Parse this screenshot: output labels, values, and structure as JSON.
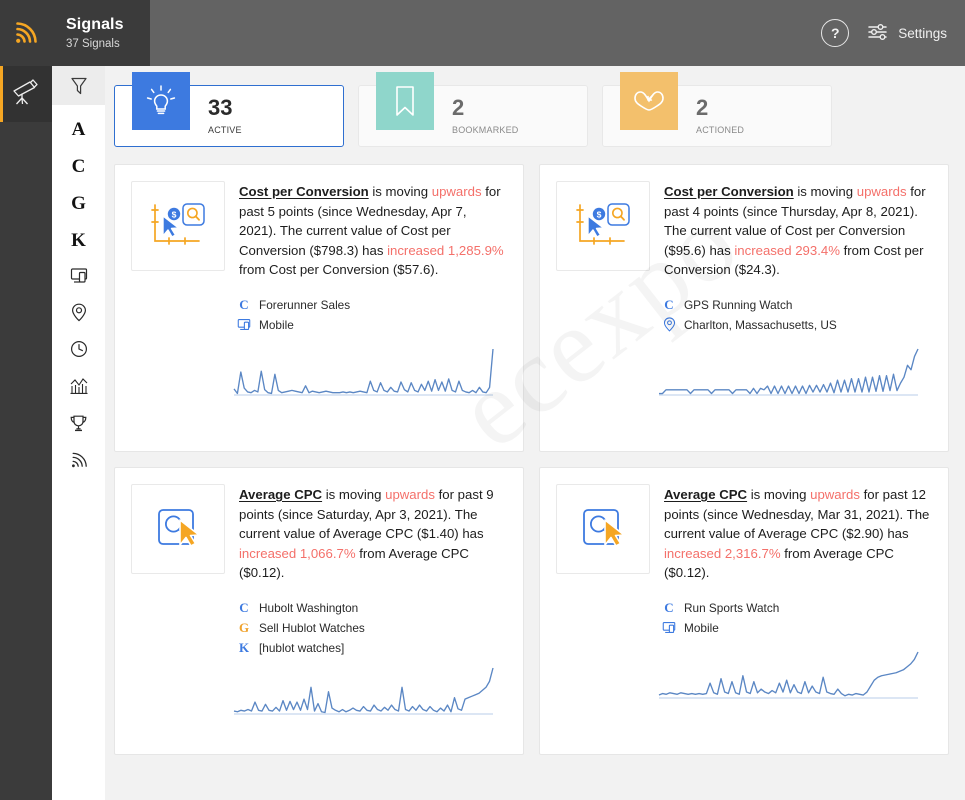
{
  "header": {
    "brand_icon": "rss-signal-icon",
    "title": "Signals",
    "subtitle": "37 Signals",
    "help_label": "?",
    "settings_label": "Settings"
  },
  "rail": {
    "active_item": "telescope-icon"
  },
  "filters": {
    "top_icon": "funnel-filter-icon",
    "items": [
      {
        "type": "letter",
        "label": "A",
        "name": "filter-letter-a"
      },
      {
        "type": "letter",
        "label": "C",
        "name": "filter-letter-c"
      },
      {
        "type": "letter",
        "label": "G",
        "name": "filter-letter-g"
      },
      {
        "type": "letter",
        "label": "K",
        "name": "filter-letter-k"
      },
      {
        "type": "icon",
        "label": "device-icon",
        "name": "filter-device"
      },
      {
        "type": "icon",
        "label": "location-pin-icon",
        "name": "filter-location"
      },
      {
        "type": "icon",
        "label": "clock-icon",
        "name": "filter-time"
      },
      {
        "type": "icon",
        "label": "bar-chart-icon",
        "name": "filter-metrics"
      },
      {
        "type": "icon",
        "label": "trophy-icon",
        "name": "filter-goals"
      },
      {
        "type": "icon",
        "label": "rss-signal-icon",
        "name": "filter-signals"
      }
    ]
  },
  "stats": [
    {
      "count": "33",
      "label": "Active",
      "icon": "lightbulb-icon",
      "color": "#3d7ae0",
      "selected": true
    },
    {
      "count": "2",
      "label": "Bookmarked",
      "icon": "bookmark-icon",
      "color": "#8fd6cb",
      "selected": false
    },
    {
      "count": "2",
      "label": "Actioned",
      "icon": "infinity-action-icon",
      "color": "#f3c06c",
      "selected": false
    }
  ],
  "watermark": "ecexpo",
  "cards": [
    {
      "thumb_icon": "cost-per-conversion-icon",
      "metric": "Cost per Conversion",
      "text_1": " is moving ",
      "direction": "upwards",
      "text_2": " for past 5 points (since Wednesday, Apr 7, 2021). The current value of Cost per Conversion ($798.3) has ",
      "change": "increased 1,285.9%",
      "text_3": " from Cost per Conversion ($57.6).",
      "meta": [
        {
          "badge": "C",
          "badge_class": "c",
          "icon": "",
          "label": "Forerunner Sales"
        },
        {
          "badge": "",
          "badge_class": "",
          "icon": "device-icon",
          "label": "Mobile"
        }
      ],
      "chart_data": {
        "type": "line",
        "title": "Cost per Conversion sparkline",
        "xlabel": "",
        "ylabel": "",
        "grid": false,
        "legend": "none",
        "values": [
          8,
          2,
          30,
          9,
          4,
          3,
          6,
          4,
          31,
          7,
          3,
          2,
          27,
          6,
          3,
          4,
          5,
          6,
          5,
          4,
          3,
          12,
          3,
          5,
          4,
          3,
          4,
          5,
          4,
          3,
          3,
          3,
          4,
          3,
          4,
          3,
          4,
          5,
          4,
          3,
          18,
          6,
          4,
          16,
          6,
          4,
          10,
          5,
          4,
          17,
          7,
          4,
          16,
          6,
          4,
          14,
          6,
          18,
          5,
          20,
          6,
          17,
          5,
          21,
          6,
          4,
          18,
          6,
          4,
          3,
          6,
          3,
          10,
          4,
          3,
          10,
          60
        ]
      }
    },
    {
      "thumb_icon": "cost-per-conversion-icon",
      "metric": "Cost per Conversion",
      "text_1": " is moving ",
      "direction": "upwards",
      "text_2": " for past 4 points (since Thursday, Apr 8, 2021). The current value of Cost per Conversion ($95.6) has ",
      "change": "increased 293.4%",
      "text_3": " from Cost per Conversion ($24.3).",
      "meta": [
        {
          "badge": "C",
          "badge_class": "c",
          "icon": "",
          "label": "GPS Running Watch"
        },
        {
          "badge": "",
          "badge_class": "",
          "icon": "location-pin-icon",
          "label": "Charlton, Massachusetts, US"
        }
      ],
      "chart_data": {
        "type": "line",
        "title": "Cost per Conversion sparkline",
        "xlabel": "",
        "ylabel": "",
        "grid": false,
        "legend": "none",
        "values": [
          2,
          2,
          7,
          7,
          7,
          7,
          7,
          7,
          7,
          2,
          7,
          7,
          7,
          7,
          7,
          2,
          7,
          7,
          7,
          7,
          7,
          2,
          7,
          7,
          7,
          7,
          2,
          9,
          2,
          9,
          7,
          12,
          2,
          12,
          2,
          12,
          2,
          12,
          2,
          12,
          2,
          12,
          2,
          13,
          4,
          13,
          4,
          14,
          4,
          16,
          3,
          20,
          4,
          20,
          4,
          22,
          4,
          22,
          4,
          24,
          4,
          24,
          5,
          26,
          5,
          26,
          6,
          28,
          6,
          16,
          24,
          40,
          34,
          52,
          62
        ]
      }
    },
    {
      "thumb_icon": "average-cpc-icon",
      "metric": "Average CPC",
      "text_1": " is moving ",
      "direction": "upwards",
      "text_2": " for past 9 points (since Saturday, Apr 3, 2021). The current value of Average CPC ($1.40) has ",
      "change": "increased 1,066.7%",
      "text_3": " from Average CPC ($0.12).",
      "meta": [
        {
          "badge": "C",
          "badge_class": "c",
          "icon": "",
          "label": "Hubolt Washington"
        },
        {
          "badge": "G",
          "badge_class": "g",
          "icon": "",
          "label": "Sell Hublot Watches"
        },
        {
          "badge": "K",
          "badge_class": "k",
          "icon": "",
          "label": "[hublot watches]"
        }
      ],
      "chart_data": {
        "type": "line",
        "title": "Average CPC sparkline",
        "xlabel": "",
        "ylabel": "",
        "grid": false,
        "legend": "none",
        "values": [
          4,
          3,
          5,
          4,
          6,
          4,
          16,
          5,
          4,
          13,
          5,
          4,
          9,
          4,
          18,
          5,
          17,
          6,
          16,
          5,
          20,
          6,
          36,
          4,
          14,
          3,
          2,
          30,
          8,
          5,
          3,
          6,
          3,
          5,
          8,
          5,
          4,
          10,
          5,
          4,
          12,
          6,
          4,
          9,
          5,
          12,
          6,
          4,
          36,
          6,
          4,
          10,
          5,
          12,
          6,
          4,
          10,
          5,
          3,
          8,
          4,
          12,
          3,
          22,
          7,
          5,
          20,
          22,
          24,
          26,
          28,
          32,
          36,
          44,
          62
        ]
      }
    },
    {
      "thumb_icon": "average-cpc-icon",
      "metric": "Average CPC",
      "text_1": " is moving ",
      "direction": "upwards",
      "text_2": " for past 12 points (since Wednesday, Mar 31, 2021). The current value of Average CPC ($2.90) has ",
      "change": "increased 2,316.7%",
      "text_3": " from Average CPC ($0.12).",
      "meta": [
        {
          "badge": "C",
          "badge_class": "c",
          "icon": "",
          "label": "Run Sports Watch"
        },
        {
          "badge": "",
          "badge_class": "",
          "icon": "device-icon",
          "label": "Mobile"
        }
      ],
      "chart_data": {
        "type": "line",
        "title": "Average CPC sparkline",
        "xlabel": "",
        "ylabel": "",
        "grid": false,
        "legend": "none",
        "values": [
          4,
          6,
          5,
          7,
          6,
          5,
          7,
          6,
          5,
          6,
          5,
          6,
          5,
          6,
          20,
          7,
          5,
          26,
          8,
          6,
          22,
          7,
          5,
          30,
          8,
          6,
          22,
          7,
          12,
          8,
          6,
          10,
          7,
          20,
          8,
          24,
          7,
          18,
          8,
          6,
          22,
          7,
          16,
          8,
          6,
          28,
          8,
          6,
          5,
          12,
          6,
          3,
          5,
          4,
          6,
          5,
          4,
          8,
          16,
          24,
          28,
          30,
          31,
          32,
          33,
          34,
          36,
          38,
          42,
          46,
          52,
          62
        ]
      }
    }
  ]
}
